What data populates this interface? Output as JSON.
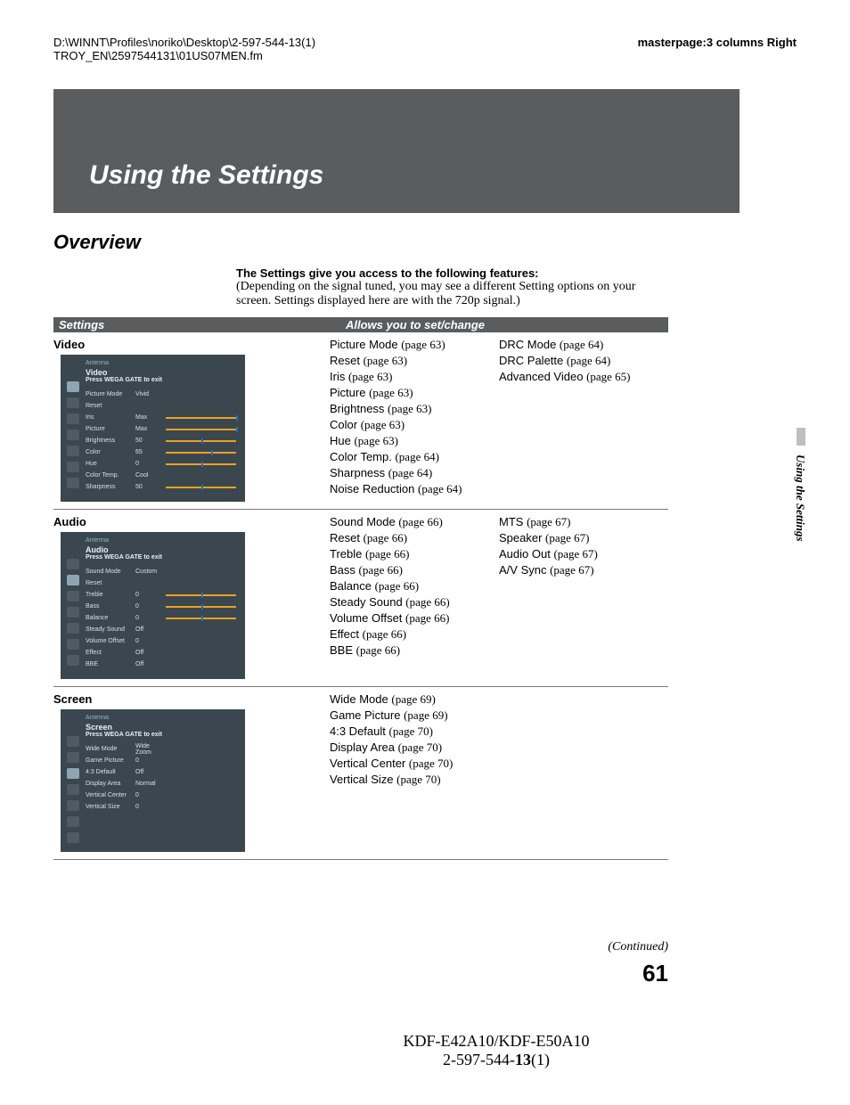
{
  "header": {
    "path_line1": "D:\\WINNT\\Profiles\\noriko\\Desktop\\2-597-544-13(1)",
    "path_line2": "TROY_EN\\2597544131\\01US07MEN.fm",
    "masterpage": "masterpage:3 columns Right"
  },
  "chapter_title": "Using the Settings",
  "overview_label": "Overview",
  "intro_bold": "The Settings give you access to the following features:",
  "intro_plain": "(Depending on the signal tuned, you may see a different Setting options on your screen. Settings displayed here are with the 720p signal.)",
  "table_headers": {
    "col1": "Settings",
    "col2": "Allows you to set/change"
  },
  "side_label": "Using the Settings",
  "continued": "(Continued)",
  "page_number": "61",
  "footer": {
    "model": "KDF-E42A10/KDF-E50A10",
    "doc1": "2-597-544-",
    "doc2": "13",
    "doc3": "(1)"
  },
  "sections": [
    {
      "title": "Video",
      "menu": {
        "antenna": "Antenna",
        "menu_title": "Video",
        "sub": "Press WEGA GATE to exit",
        "rows": [
          {
            "label": "Picture Mode",
            "value": "Vivid",
            "slider": false
          },
          {
            "label": "Reset",
            "value": "",
            "slider": false
          },
          {
            "label": "Iris",
            "value": "Max",
            "slider": true,
            "p": "100%"
          },
          {
            "label": "Picture",
            "value": "Max",
            "slider": true,
            "p": "100%"
          },
          {
            "label": "Brightness",
            "value": "50",
            "slider": true,
            "p": "50%"
          },
          {
            "label": "Color",
            "value": "65",
            "slider": true,
            "p": "65%"
          },
          {
            "label": "Hue",
            "value": "0",
            "slider": true,
            "p": "50%"
          },
          {
            "label": "Color Temp.",
            "value": "Cool",
            "slider": false
          },
          {
            "label": "Sharpness",
            "value": "50",
            "slider": true,
            "p": "50%"
          }
        ]
      },
      "col_a": [
        {
          "name": "Picture Mode",
          "page": "63"
        },
        {
          "name": "Reset",
          "page": "63"
        },
        {
          "name": "Iris",
          "page": "63"
        },
        {
          "name": "Picture",
          "page": "63"
        },
        {
          "name": "Brightness",
          "page": "63"
        },
        {
          "name": "Color",
          "page": "63"
        },
        {
          "name": "Hue",
          "page": "63"
        },
        {
          "name": "Color Temp.",
          "page": "64"
        },
        {
          "name": "Sharpness",
          "page": "64"
        },
        {
          "name": "Noise Reduction",
          "page": "64"
        }
      ],
      "col_b": [
        {
          "name": "DRC Mode",
          "page": "64"
        },
        {
          "name": "DRC Palette",
          "page": "64"
        },
        {
          "name": "Advanced Video",
          "page": "65"
        }
      ]
    },
    {
      "title": "Audio",
      "menu": {
        "antenna": "Antenna",
        "menu_title": "Audio",
        "sub": "Press WEGA GATE to exit",
        "rows": [
          {
            "label": "Sound Mode",
            "value": "Custom",
            "slider": false
          },
          {
            "label": "Reset",
            "value": "",
            "slider": false
          },
          {
            "label": "Treble",
            "value": "0",
            "slider": true,
            "p": "50%"
          },
          {
            "label": "Bass",
            "value": "0",
            "slider": true,
            "p": "50%"
          },
          {
            "label": "Balance",
            "value": "0",
            "slider": true,
            "p": "50%"
          },
          {
            "label": "Steady Sound",
            "value": "Off",
            "slider": false
          },
          {
            "label": "Volume Offset",
            "value": "0",
            "slider": false
          },
          {
            "label": "Effect",
            "value": "Off",
            "slider": false
          },
          {
            "label": "BBE",
            "value": "Off",
            "slider": false
          }
        ]
      },
      "col_a": [
        {
          "name": "Sound Mode",
          "page": "66"
        },
        {
          "name": "Reset",
          "page": "66"
        },
        {
          "name": "Treble",
          "page": "66"
        },
        {
          "name": "Bass",
          "page": "66"
        },
        {
          "name": "Balance",
          "page": "66"
        },
        {
          "name": "Steady Sound",
          "page": "66"
        },
        {
          "name": "Volume Offset",
          "page": "66"
        },
        {
          "name": "Effect",
          "page": "66"
        },
        {
          "name": "BBE",
          "page": "66"
        }
      ],
      "col_b": [
        {
          "name": "MTS",
          "page": "67"
        },
        {
          "name": "Speaker",
          "page": "67"
        },
        {
          "name": "Audio Out",
          "page": "67"
        },
        {
          "name": "A/V Sync",
          "page": "67"
        }
      ]
    },
    {
      "title": "Screen",
      "menu": {
        "antenna": "Antenna",
        "menu_title": "Screen",
        "sub": "Press WEGA GATE to exit",
        "rows": [
          {
            "label": "Wide Mode",
            "value": "Wide Zoom",
            "slider": false
          },
          {
            "label": "Game Picture",
            "value": "0",
            "slider": false
          },
          {
            "label": "4:3 Default",
            "value": "Off",
            "slider": false
          },
          {
            "label": "Display Area",
            "value": "Normal",
            "slider": false
          },
          {
            "label": "Vertical Center",
            "value": "0",
            "slider": false
          },
          {
            "label": "Vertical Size",
            "value": "0",
            "slider": false
          }
        ]
      },
      "col_a": [
        {
          "name": "Wide Mode",
          "page": "69"
        },
        {
          "name": "Game Picture",
          "page": "69"
        },
        {
          "name": "4:3 Default",
          "page": "70"
        },
        {
          "name": "Display Area",
          "page": "70"
        },
        {
          "name": "Vertical Center",
          "page": "70"
        },
        {
          "name": "Vertical Size",
          "page": "70"
        }
      ],
      "col_b": []
    }
  ]
}
